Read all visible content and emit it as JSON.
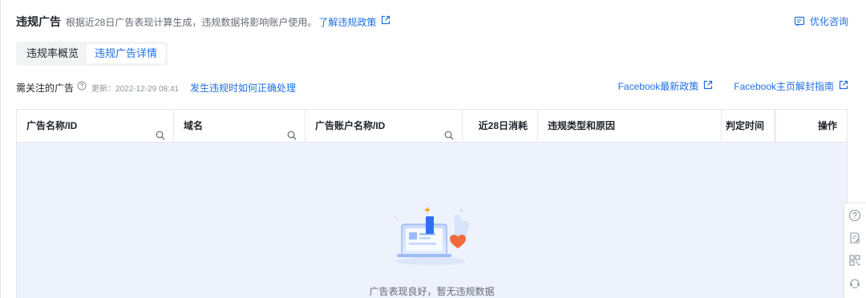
{
  "header": {
    "title": "违规广告",
    "description": "根据近28日广告表现计算生成，违规数据将影响账户使用。",
    "policy_link": "了解违规政策",
    "consult": "优化咨询"
  },
  "tabs": [
    {
      "label": "违规率概览",
      "active": false
    },
    {
      "label": "违规广告详情",
      "active": true
    }
  ],
  "subheader": {
    "label": "需关注的广告",
    "updated": "更新：2022-12-29 08:41",
    "howto_link": "发生违规时如何正确处理",
    "fb_policy_link": "Facebook最新政策",
    "fb_unlock_link": "Facebook主页解封指南"
  },
  "table": {
    "columns": [
      {
        "label": "广告名称/ID",
        "searchable": true
      },
      {
        "label": "域名",
        "searchable": true
      },
      {
        "label": "广告账户名称/ID",
        "searchable": true
      },
      {
        "label": "近28日消耗",
        "searchable": false
      },
      {
        "label": "违规类型和原因",
        "searchable": false
      },
      {
        "label": "判定时间",
        "searchable": false
      },
      {
        "label": "操作",
        "searchable": false
      }
    ],
    "empty_text": "广告表现良好，暂无违规数据"
  },
  "colors": {
    "accent": "#1f6fe5",
    "empty_bg": "#eef2fc",
    "heart": "#f36a3a"
  },
  "icons": {
    "external_link": "external-link-icon",
    "consult": "chat-icon",
    "search": "search-icon",
    "help": "question-icon",
    "toolbar": [
      "help-circle-icon",
      "edit-note-icon",
      "qr-code-icon",
      "customer-service-icon"
    ]
  }
}
